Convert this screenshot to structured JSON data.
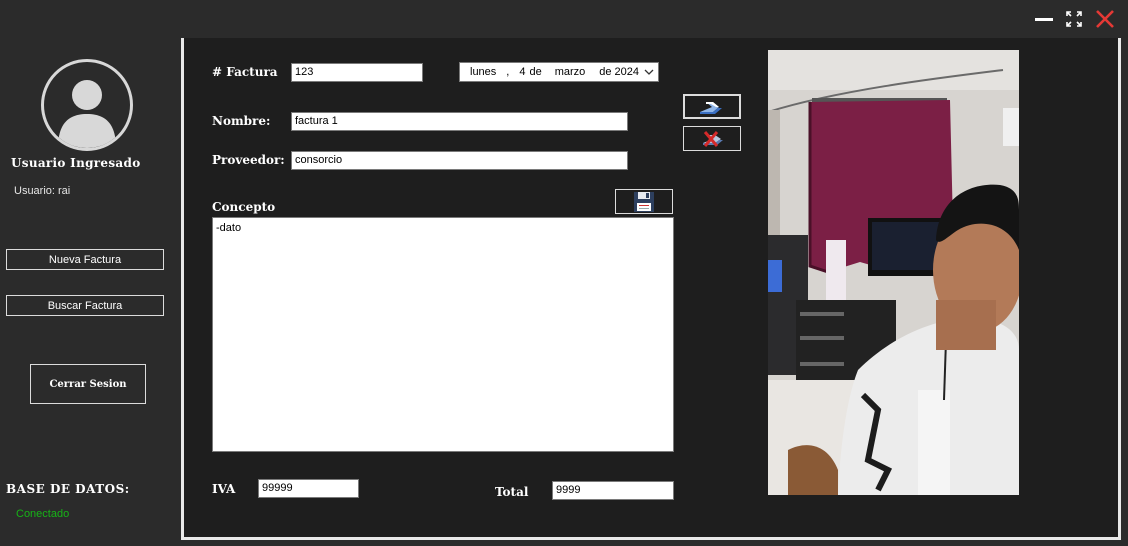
{
  "window": {
    "minimize_icon": "minimize-icon",
    "maximize_icon": "maximize-icon",
    "close_icon": "close-icon",
    "close_color": "#e53935"
  },
  "sidebar": {
    "user_title": "Usuario Ingresado",
    "user_label": "Usuario: rai",
    "new_invoice": "Nueva Factura",
    "search_invoice": "Buscar Factura",
    "logout": "Cerrar Sesion",
    "db_title": "BASE DE DATOS:",
    "db_status": "Conectado",
    "db_status_color": "#17b317"
  },
  "form": {
    "invoice_label": "# Factura",
    "invoice_value": "123",
    "date": {
      "weekday": "lunes",
      "sep": ",",
      "day": "4",
      "de1": "de",
      "month": "marzo",
      "de2": "de",
      "year": "2024"
    },
    "name_label": "Nombre:",
    "name_value": "factura 1",
    "provider_label": "Proveedor:",
    "provider_value": "consorcio",
    "concept_label": "Concepto",
    "concept_value": "-dato",
    "iva_label": "IVA",
    "iva_value": "99999",
    "total_label": "Total",
    "total_value": "9999"
  },
  "icons": {
    "next": "arrow-forward-icon",
    "cancel": "cancel-icon",
    "save": "save-disk-icon",
    "avatar": "user-avatar-icon"
  }
}
